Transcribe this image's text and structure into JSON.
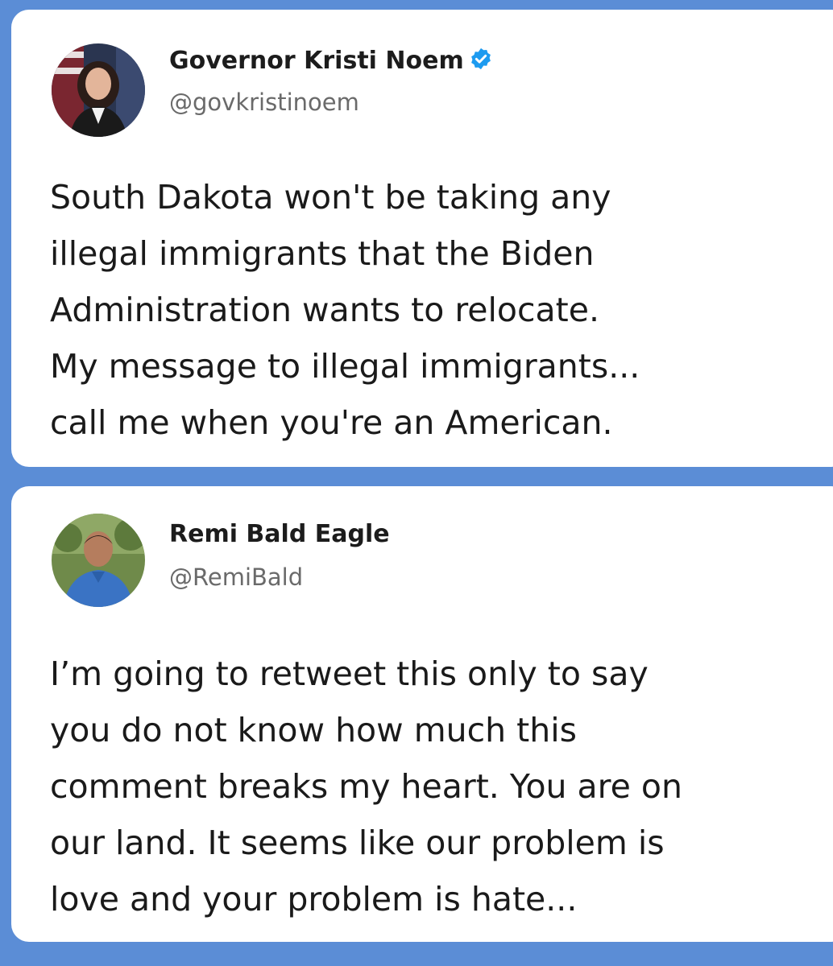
{
  "tweets": [
    {
      "display_name": "Governor Kristi Noem",
      "verified": true,
      "handle": "@govkristinoem",
      "avatar": "avatar-woman-flag-background",
      "text_lines": [
        "South Dakota won't be taking any",
        "illegal immigrants that the Biden",
        "Administration wants to relocate.",
        "My message to illegal immigrants...",
        "call me when you're an American."
      ]
    },
    {
      "display_name": "Remi Bald Eagle",
      "verified": false,
      "handle": "@RemiBald",
      "avatar": "avatar-man-blue-shirt",
      "text_lines": [
        "I’m going to retweet this only to say",
        "you do not know how much this",
        "comment breaks my heart. You are on",
        "our land. It seems like our problem is",
        "love and your problem is hate..."
      ]
    }
  ],
  "colors": {
    "background": "#5b8dd6",
    "card": "#ffffff",
    "verified_badge": "#1d9bf0",
    "name_text": "#1c1c1c",
    "handle_text": "#6a6a6a"
  }
}
